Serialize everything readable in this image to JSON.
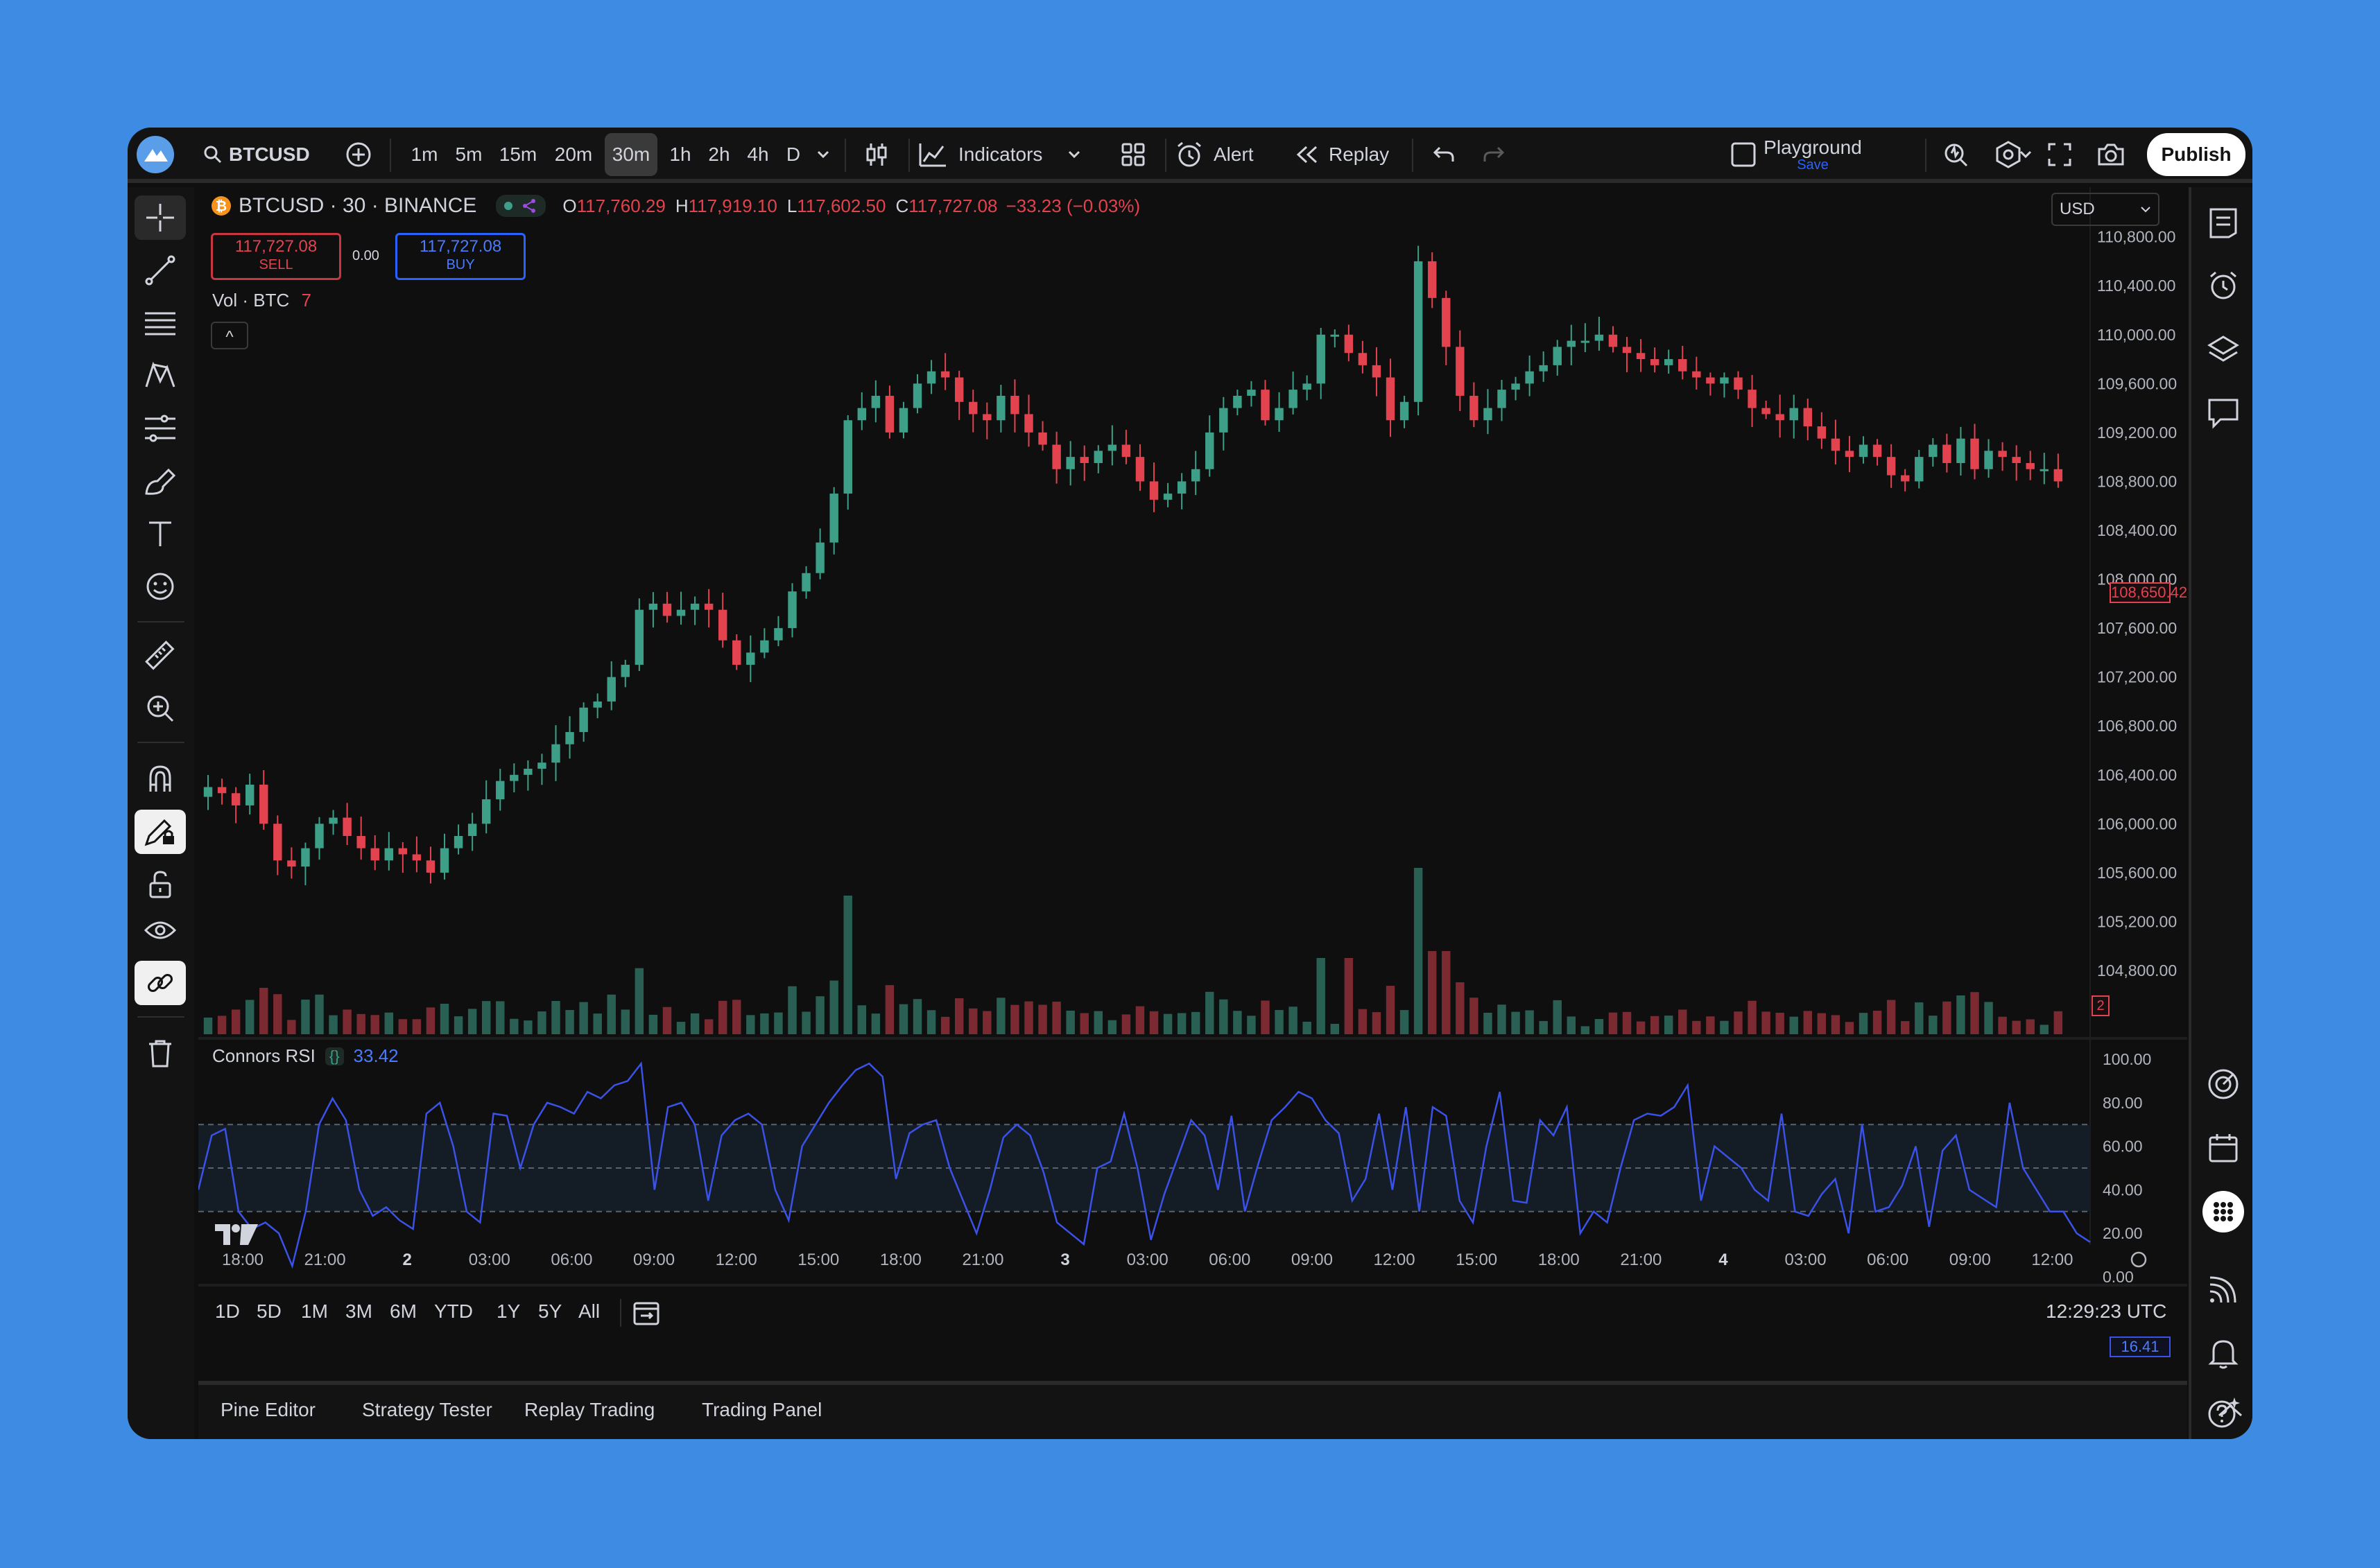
{
  "toolbar": {
    "symbol": "BTCUSD",
    "intervals": [
      "1m",
      "5m",
      "15m",
      "20m",
      "30m",
      "1h",
      "2h",
      "4h",
      "D"
    ],
    "active_interval": "30m",
    "indicators_label": "Indicators",
    "alert_label": "Alert",
    "replay_label": "Replay",
    "layout_name": "Playground",
    "layout_sub": "Save",
    "publish_label": "Publish"
  },
  "legend": {
    "title": "BTCUSD · 30 · BINANCE",
    "o_label": "O",
    "o_value": "117,760.29",
    "h_label": "H",
    "h_value": "117,919.10",
    "l_label": "L",
    "l_value": "117,602.50",
    "c_label": "C",
    "c_value": "117,727.08",
    "change": "−33.23 (−0.03%)",
    "sell_price": "117,727.08",
    "sell_label": "SELL",
    "spread": "0.00",
    "buy_price": "117,727.08",
    "buy_label": "BUY",
    "vol_label": "Vol · BTC",
    "vol_value": "7",
    "currency": "USD",
    "collapse": "^"
  },
  "rsi": {
    "name": "Connors RSI",
    "braces": "{}",
    "value": "33.42",
    "last": "16.41"
  },
  "price_tag": "108,650.42",
  "vol_tag": "2",
  "time_buttons": [
    "1D",
    "5D",
    "1M",
    "3M",
    "6M",
    "YTD",
    "1Y",
    "5Y",
    "All"
  ],
  "clock": "12:29:23 UTC",
  "bottom_tabs": [
    "Pine Editor",
    "Strategy Tester",
    "Replay Trading",
    "Trading Panel"
  ],
  "colors": {
    "up": "#3d9f87",
    "down": "#e3424f",
    "rsi": "#3b52e8",
    "accent": "#2962ff"
  },
  "chart_data": [
    {
      "type": "candlestick",
      "title": "BTCUSD · 30 · BINANCE",
      "y_ticks": [
        "110,800.00",
        "110,400.00",
        "110,000.00",
        "109,600.00",
        "109,200.00",
        "108,800.00",
        "108,400.00",
        "108,000.00",
        "107,600.00",
        "107,200.00",
        "106,800.00",
        "106,400.00",
        "106,000.00",
        "105,600.00",
        "105,200.00",
        "104,800.00"
      ],
      "y_tick_values": [
        110800,
        110400,
        110000,
        109600,
        109200,
        108800,
        108400,
        108000,
        107600,
        107200,
        106800,
        106400,
        106000,
        105600,
        105200,
        104800
      ],
      "x_ticks": [
        "18:00",
        "21:00",
        "2",
        "03:00",
        "06:00",
        "09:00",
        "12:00",
        "15:00",
        "18:00",
        "21:00",
        "3",
        "03:00",
        "06:00",
        "09:00",
        "12:00",
        "15:00",
        "18:00",
        "21:00",
        "4",
        "03:00",
        "06:00",
        "09:00",
        "12:00"
      ],
      "close": [
        106300,
        106250,
        106150,
        106320,
        106000,
        105700,
        105650,
        105800,
        106000,
        106050,
        105900,
        105800,
        105700,
        105800,
        105750,
        105700,
        105600,
        105800,
        105900,
        106000,
        106200,
        106350,
        106400,
        106450,
        106500,
        106650,
        106750,
        106950,
        107000,
        107200,
        107300,
        107750,
        107800,
        107700,
        107750,
        107800,
        107750,
        107500,
        107300,
        107400,
        107500,
        107600,
        107900,
        108050,
        108300,
        108700,
        109300,
        109400,
        109500,
        109200,
        109400,
        109600,
        109700,
        109650,
        109450,
        109350,
        109300,
        109500,
        109350,
        109200,
        109100,
        108900,
        109000,
        108950,
        109050,
        109100,
        109000,
        108800,
        108650,
        108700,
        108800,
        108900,
        109200,
        109400,
        109500,
        109550,
        109300,
        109400,
        109550,
        109600,
        110000,
        110000,
        109850,
        109750,
        109650,
        109300,
        109450,
        110600,
        110300,
        109900,
        109500,
        109300,
        109400,
        109550,
        109600,
        109700,
        109750,
        109900,
        109950,
        109950,
        110000,
        109900,
        109850,
        109800,
        109750,
        109800,
        109700,
        109650,
        109600,
        109650,
        109550,
        109400,
        109350,
        109300,
        109400,
        109250,
        109150,
        109050,
        109000,
        109100,
        109000,
        108850,
        108800,
        109000,
        109100,
        108950,
        109150,
        108900,
        109050,
        109000,
        108950,
        108900,
        108900,
        108800
      ],
      "volume_max_label_count": 0
    },
    {
      "type": "line",
      "title": "Connors RSI",
      "y_ticks": [
        "100.00",
        "80.00",
        "60.00",
        "40.00",
        "20.00",
        "0.00"
      ],
      "y_tick_values": [
        100,
        80,
        60,
        40,
        20,
        0
      ],
      "band": [
        30,
        70
      ],
      "values": [
        40,
        65,
        68,
        30,
        22,
        25,
        20,
        5,
        30,
        70,
        82,
        72,
        40,
        28,
        32,
        26,
        22,
        75,
        80,
        60,
        30,
        25,
        75,
        74,
        50,
        70,
        80,
        78,
        75,
        85,
        82,
        88,
        90,
        98,
        40,
        78,
        80,
        70,
        35,
        65,
        72,
        75,
        70,
        40,
        26,
        60,
        70,
        80,
        88,
        95,
        98,
        92,
        45,
        66,
        70,
        72,
        50,
        35,
        20,
        40,
        64,
        70,
        65,
        48,
        25,
        20,
        15,
        50,
        53,
        75,
        50,
        17,
        38,
        55,
        72,
        65,
        40,
        74,
        30,
        52,
        72,
        78,
        85,
        82,
        72,
        66,
        35,
        45,
        75,
        40,
        78,
        30,
        78,
        74,
        35,
        25,
        60,
        85,
        35,
        34,
        72,
        65,
        78,
        20,
        30,
        25,
        50,
        72,
        75,
        74,
        78,
        88,
        35,
        60,
        55,
        50,
        40,
        35,
        75,
        30,
        28,
        38,
        45,
        20,
        70,
        30,
        32,
        42,
        60,
        23,
        58,
        65,
        40,
        36,
        32,
        80,
        50,
        40,
        30,
        30,
        20,
        16
      ]
    }
  ]
}
